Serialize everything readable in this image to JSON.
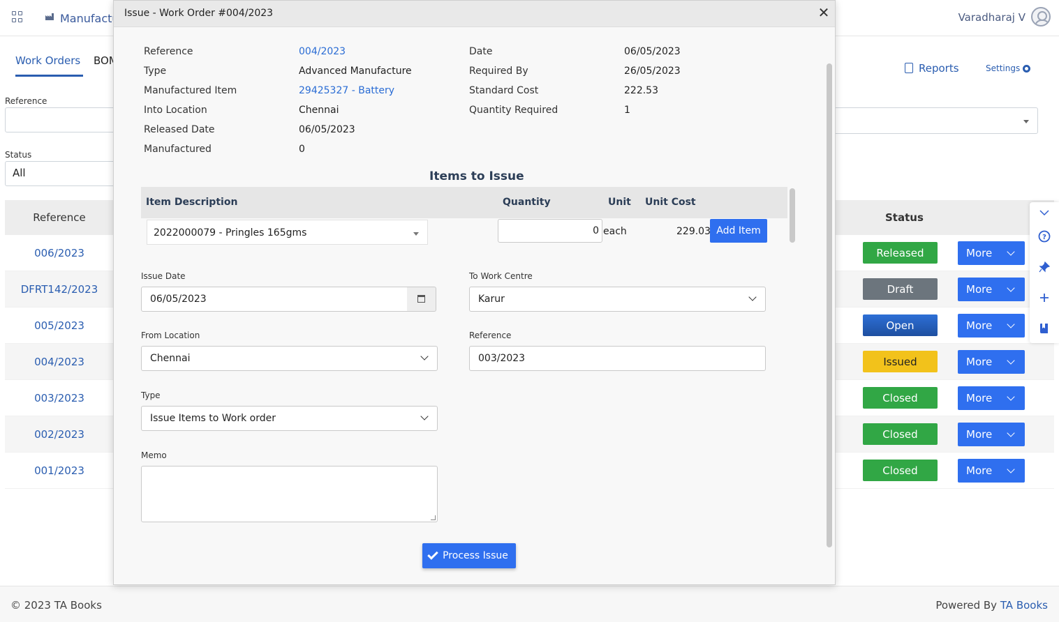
{
  "app": {
    "module_title": "Manufactu",
    "user_name": "Varadharaj V"
  },
  "background": {
    "tabs": [
      "Work Orders",
      "BOM"
    ],
    "filters": {
      "reference_label": "Reference",
      "reference_value": "",
      "status_label": "Status",
      "status_value": "All"
    },
    "links": {
      "reports": "Reports",
      "settings": "Settings"
    },
    "table": {
      "reference_header": "Reference",
      "status_header": "Status",
      "more_label": "More",
      "rows": [
        {
          "reference": "006/2023",
          "status": "Released"
        },
        {
          "reference": "DFRT142/2023",
          "status": "Draft"
        },
        {
          "reference": "005/2023",
          "status": "Open"
        },
        {
          "reference": "004/2023",
          "status": "Issued"
        },
        {
          "reference": "003/2023",
          "status": "Closed"
        },
        {
          "reference": "002/2023",
          "status": "Closed"
        },
        {
          "reference": "001/2023",
          "status": "Closed"
        }
      ]
    },
    "side_toolbar_icons": [
      "chevron-down-icon",
      "help-icon",
      "pin-icon",
      "plus-icon",
      "book-icon"
    ]
  },
  "modal": {
    "title": "Issue - Work Order #004/2023",
    "info": {
      "reference_label": "Reference",
      "reference_value": "004/2023",
      "type_label": "Type",
      "type_value": "Advanced Manufacture",
      "item_label": "Manufactured Item",
      "item_value": "29425327 - Battery",
      "into_location_label": "Into Location",
      "into_location_value": "Chennai",
      "released_date_label": "Released Date",
      "released_date_value": "06/05/2023",
      "manufactured_label": "Manufactured",
      "manufactured_value": "0",
      "date_label": "Date",
      "date_value": "06/05/2023",
      "required_by_label": "Required By",
      "required_by_value": "26/05/2023",
      "standard_cost_label": "Standard Cost",
      "standard_cost_value": "222.53",
      "qty_required_label": "Quantity Required",
      "qty_required_value": "1"
    },
    "items": {
      "title": "Items to Issue",
      "headers": {
        "description": "Item Description",
        "quantity": "Quantity",
        "unit": "Unit",
        "unit_cost": "Unit Cost"
      },
      "row": {
        "description": "2022000079 - Pringles 165gms",
        "quantity": "0",
        "unit": "each",
        "unit_cost": "229.03"
      },
      "add_label": "Add Item"
    },
    "form": {
      "issue_date_label": "Issue Date",
      "issue_date_value": "06/05/2023",
      "to_work_centre_label": "To Work Centre",
      "to_work_centre_value": "Karur",
      "from_location_label": "From Location",
      "from_location_value": "Chennai",
      "reference_label": "Reference",
      "reference_value": "003/2023",
      "type_label": "Type",
      "type_value": "Issue Items to Work order",
      "memo_label": "Memo",
      "memo_value": ""
    },
    "process_label": "Process Issue"
  },
  "footer": {
    "copyright": "© 2023 TA Books",
    "powered_prefix": "Powered By",
    "powered_brand": "TA Books"
  },
  "colors": {
    "accent": "#2f6fef",
    "link": "#2a6cd4",
    "released": "#31a745",
    "draft": "#6c757d",
    "open": "#1e4fa0",
    "issued": "#f2c21b",
    "closed": "#31a745"
  }
}
